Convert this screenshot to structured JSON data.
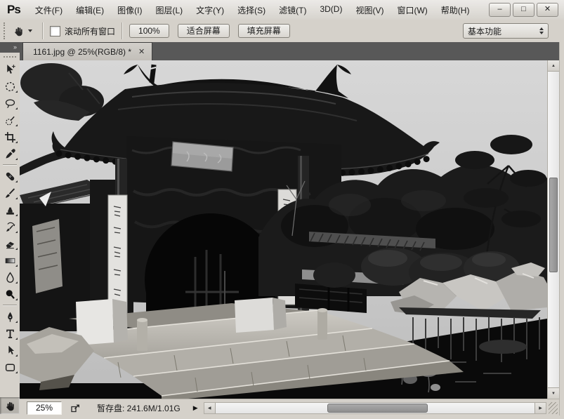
{
  "window": {
    "logo": "Ps",
    "controls": [
      {
        "icon": "minimize-icon",
        "glyph": "–"
      },
      {
        "icon": "maximize-icon",
        "glyph": "□"
      },
      {
        "icon": "close-icon",
        "glyph": "✕"
      }
    ]
  },
  "menu_bar": {
    "items": [
      {
        "label": "文件(F)"
      },
      {
        "label": "编辑(E)"
      },
      {
        "label": "图像(I)"
      },
      {
        "label": "图层(L)"
      },
      {
        "label": "文字(Y)"
      },
      {
        "label": "选择(S)"
      },
      {
        "label": "滤镜(T)"
      },
      {
        "label": "3D(D)"
      },
      {
        "label": "视图(V)"
      },
      {
        "label": "窗口(W)"
      },
      {
        "label": "帮助(H)"
      }
    ]
  },
  "options_bar": {
    "active_tool_icon": "hand-icon",
    "scroll_all_windows": {
      "label": "滚动所有窗口",
      "checked": false
    },
    "zoom_100_label": "100%",
    "fit_screen_label": "适合屏幕",
    "fill_screen_label": "填充屏幕",
    "workspace": {
      "value": "基本功能"
    }
  },
  "tab_bar": {
    "tabs": [
      {
        "title": "1161.jpg @ 25%(RGB/8) *",
        "close_glyph": "✕",
        "active": true
      }
    ]
  },
  "toolbar": {
    "collapse_glyph": "»",
    "selected_tool": "hand",
    "tools": [
      "move",
      "elliptical-marquee",
      "lasso",
      "quick-selection",
      "crop",
      "eyedropper",
      "spot-healing",
      "brush",
      "clone-stamp",
      "history-brush",
      "eraser",
      "gradient",
      "blur",
      "dodge",
      "pen",
      "type",
      "path-selection",
      "rounded-rectangle",
      "hand"
    ]
  },
  "canvas": {
    "image_description": "grayscale photo: ornate Chinese garden gate with carved dark roof, calligraphy plaque, white couplet banners on columns, stone steps, rock-lined lotus pond, trees and sky",
    "style": "grayscale"
  },
  "status_bar": {
    "zoom_field": "25%",
    "scratch_info": "暂存盘: 241.6M/1.01G",
    "menu_arrow_glyph": "▶"
  },
  "scrollbars": {
    "up": "▲",
    "down": "▼",
    "left": "◀",
    "right": "▶"
  },
  "colors": {
    "chrome": "#d5d1ca",
    "tab_bar_bg": "#585858",
    "active_tab_bg": "#c9c6c1",
    "scrollbar_thumb": "#9c9c9c",
    "canvas_dark": "#0a0a0a"
  }
}
